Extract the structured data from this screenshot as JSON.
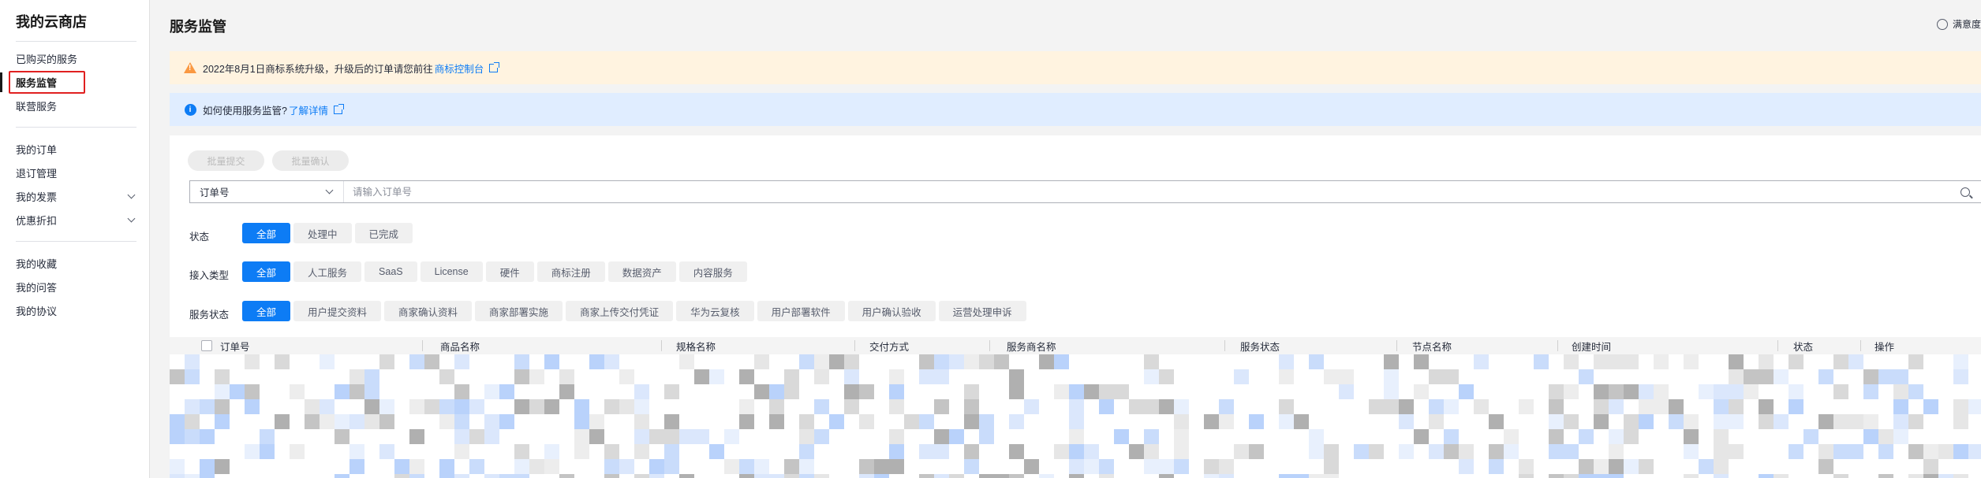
{
  "sidebar": {
    "title": "我的云商店",
    "group1": [
      {
        "label": "已购买的服务"
      },
      {
        "label": "服务监管",
        "active": true
      },
      {
        "label": "联营服务"
      }
    ],
    "group2": [
      {
        "label": "我的订单"
      },
      {
        "label": "退订管理"
      },
      {
        "label": "我的发票",
        "icon": "chevron-down-icon"
      },
      {
        "label": "优惠折扣",
        "icon": "chevron-down-icon"
      }
    ],
    "group3": [
      {
        "label": "我的收藏"
      },
      {
        "label": "我的问答"
      },
      {
        "label": "我的协议"
      }
    ]
  },
  "header": {
    "title": "服务监管",
    "satisfaction": "满意度",
    "satisfaction_icon": "smile-icon"
  },
  "banners": {
    "warning": {
      "icon": "warning-icon",
      "text": "2022年8月1日商标系统升级，升级后的订单请您前往",
      "link": "商标控制台",
      "link_icon": "external-link-icon",
      "color": "#fa9841"
    },
    "info": {
      "icon": "info-icon",
      "text": "如何使用服务监管?",
      "link": "了解详情",
      "link_icon": "external-link-icon",
      "color": "#0d7cf5"
    }
  },
  "toolbar": {
    "batch_submit": "批量提交",
    "batch_confirm": "批量确认"
  },
  "search": {
    "field_selected": "订单号",
    "placeholder": "请输入订单号",
    "icon": "search-icon"
  },
  "filters": {
    "status": {
      "label": "状态",
      "options": [
        "全部",
        "处理中",
        "已完成"
      ],
      "selected": "全部"
    },
    "access_type": {
      "label": "接入类型",
      "options": [
        "全部",
        "人工服务",
        "SaaS",
        "License",
        "硬件",
        "商标注册",
        "数据资产",
        "内容服务"
      ],
      "selected": "全部"
    },
    "service_status": {
      "label": "服务状态",
      "options": [
        "全部",
        "用户提交资料",
        "商家确认资料",
        "商家部署实施",
        "商家上传交付凭证",
        "华为云复核",
        "用户部署软件",
        "用户确认验收",
        "运营处理申诉"
      ],
      "selected": "全部"
    }
  },
  "table": {
    "columns": [
      "订单号",
      "商品名称",
      "规格名称",
      "交付方式",
      "服务商名称",
      "服务状态",
      "节点名称",
      "创建时间",
      "状态",
      "操作"
    ]
  },
  "colors": {
    "accent": "#0d7cf5",
    "warning_bg": "#fff3e0",
    "info_bg": "#e0edff",
    "highlight_border": "#e02020"
  }
}
